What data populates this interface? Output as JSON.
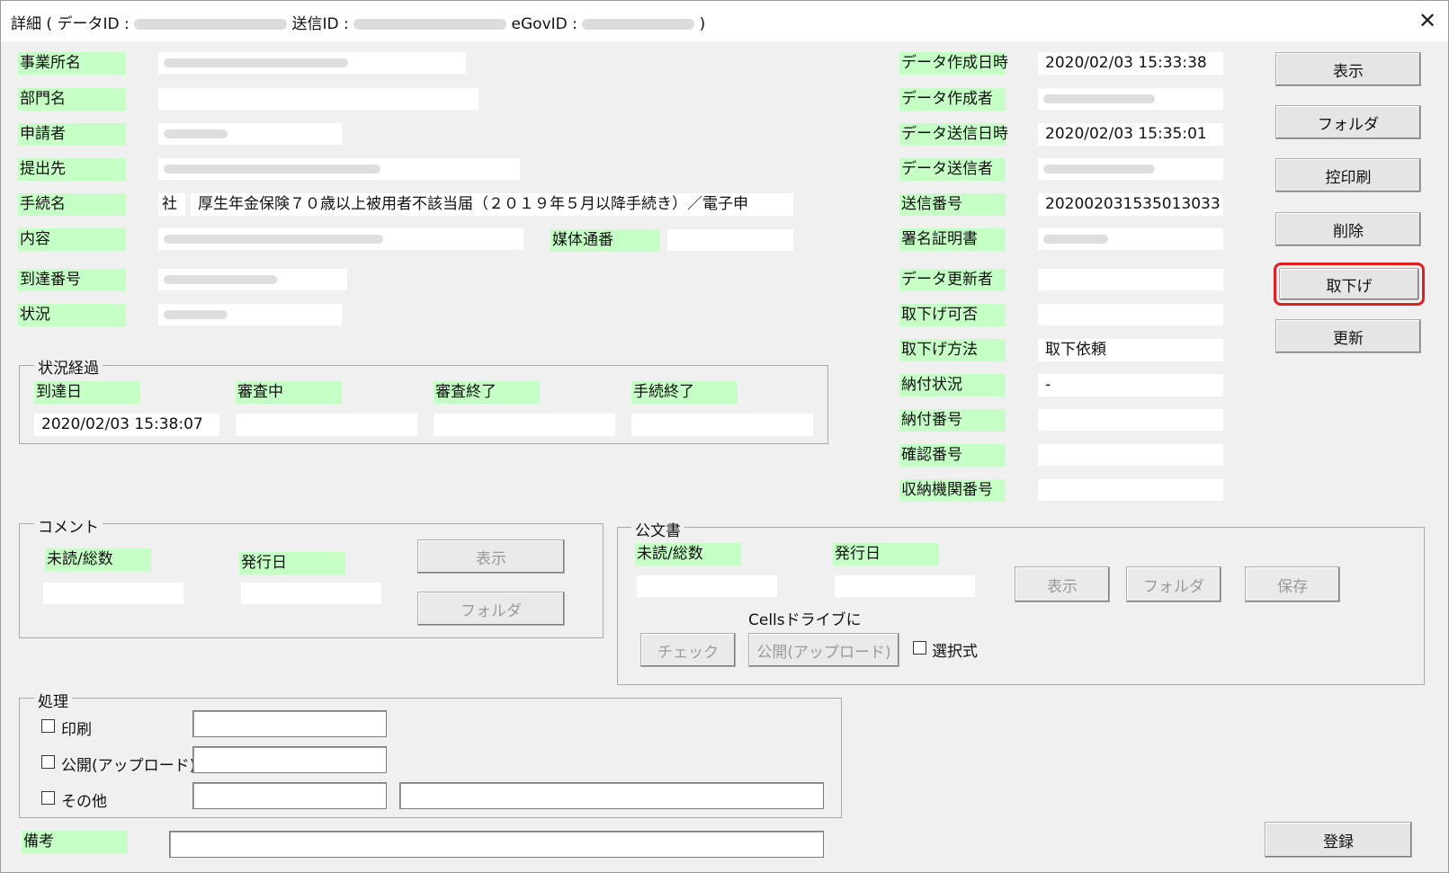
{
  "window": {
    "title_prefix": "詳細 ( データID : ",
    "title_send": " 送信ID : ",
    "title_egov": " eGovID : ",
    "title_suffix": " )",
    "close_glyph": "✕"
  },
  "left": {
    "jigyosho_label": "事業所名",
    "bumon_label": "部門名",
    "shinseisha_label": "申請者",
    "teishutsusaki_label": "提出先",
    "tetsuzuki_label": "手続名",
    "tetsuzuki_prefix": "社",
    "tetsuzuki_value": "厚生年金保険７０歳以上被用者不該当届（２０１９年５月以降手続き）／電子申",
    "naiyo_label": "内容",
    "baitai_label": "媒体通番",
    "totatsu_label": "到達番号",
    "jokyo_label": "状況"
  },
  "progress": {
    "group_title": "状況経過",
    "col1": "到達日",
    "col2": "審査中",
    "col3": "審査終了",
    "col4": "手続終了",
    "val1": "2020/02/03 15:38:07",
    "val2": "",
    "val3": "",
    "val4": ""
  },
  "right": {
    "created_at_label": "データ作成日時",
    "created_at_value": "2020/02/03 15:33:38",
    "creator_label": "データ作成者",
    "sent_at_label": "データ送信日時",
    "sent_at_value": "2020/02/03 15:35:01",
    "sender_label": "データ送信者",
    "send_no_label": "送信番号",
    "send_no_value": "202002031535013033",
    "cert_label": "署名証明書",
    "updater_label": "データ更新者",
    "withdraw_ok_label": "取下げ可否",
    "withdraw_method_label": "取下げ方法",
    "withdraw_method_value": "取下依頼",
    "payment_status_label": "納付状況",
    "payment_status_value": "-",
    "payment_no_label": "納付番号",
    "confirm_no_label": "確認番号",
    "agency_no_label": "収納機関番号"
  },
  "side_buttons": {
    "show": "表示",
    "folder": "フォルダ",
    "print_copy": "控印刷",
    "delete": "削除",
    "withdraw": "取下げ",
    "refresh": "更新"
  },
  "comment": {
    "group_title": "コメント",
    "unread_label": "未読/総数",
    "issued_label": "発行日",
    "show_btn": "表示",
    "folder_btn": "フォルダ"
  },
  "official": {
    "group_title": "公文書",
    "unread_label": "未読/総数",
    "issued_label": "発行日",
    "show_btn": "表示",
    "folder_btn": "フォルダ",
    "save_btn": "保存",
    "cells_label": "Cellsドライブに",
    "check_btn": "チェック",
    "publish_btn": "公開(アップロード)",
    "select_label": "選択式"
  },
  "process": {
    "group_title": "処理",
    "print_label": "印刷",
    "publish_label": "公開(アップロード)",
    "other_label": "その他"
  },
  "remarks": {
    "label": "備考",
    "register_btn": "登録"
  },
  "colors": {
    "label_bg": "#c6ffc6",
    "highlight": "#e02020",
    "dialog_bg": "#f0f0f0"
  }
}
